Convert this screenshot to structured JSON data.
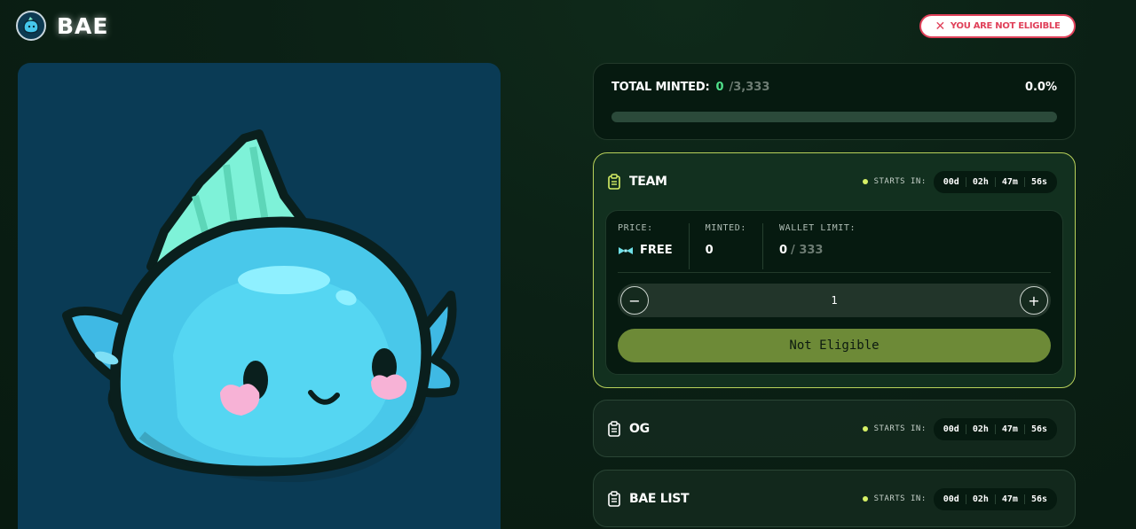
{
  "header": {
    "brand": "BAE",
    "eligibility_badge": "YOU ARE NOT ELIGIBLE"
  },
  "minted": {
    "label": "TOTAL MINTED:",
    "count": "0",
    "total": "/3,333",
    "percent_text": "0.0%",
    "progress_fraction": 0.0
  },
  "phases": [
    {
      "title": "TEAM",
      "starts_label": "STARTS IN:",
      "timer": [
        "00d",
        "02h",
        "47m",
        "56s"
      ],
      "details": {
        "price_label": "PRICE:",
        "price_value": "FREE",
        "minted_label": "MINTED:",
        "minted_value": "0",
        "wallet_limit_label": "WALLET LIMIT:",
        "wallet_limit_used": "0",
        "wallet_limit_max": "/ 333",
        "quantity": "1",
        "minus_symbol": "−",
        "plus_symbol": "+",
        "mint_button": "Not Eligible"
      }
    },
    {
      "title": "OG",
      "starts_label": "STARTS IN:",
      "timer": [
        "00d",
        "02h",
        "47m",
        "56s"
      ]
    },
    {
      "title": "BAE LIST",
      "starts_label": "STARTS IN:",
      "timer": [
        "00d",
        "02h",
        "47m",
        "56s"
      ]
    }
  ],
  "colors": {
    "accent_green": "#4fe08a",
    "active_border": "#b8d15a",
    "mint_button": "#6d8a37",
    "badge_red": "#e0415a",
    "art_background": "#0a3b55"
  },
  "icons": {
    "logo": "fish-avatar-icon",
    "badge": "close-icon",
    "phase": "clipboard-icon",
    "price": "bow-tie-icon"
  }
}
